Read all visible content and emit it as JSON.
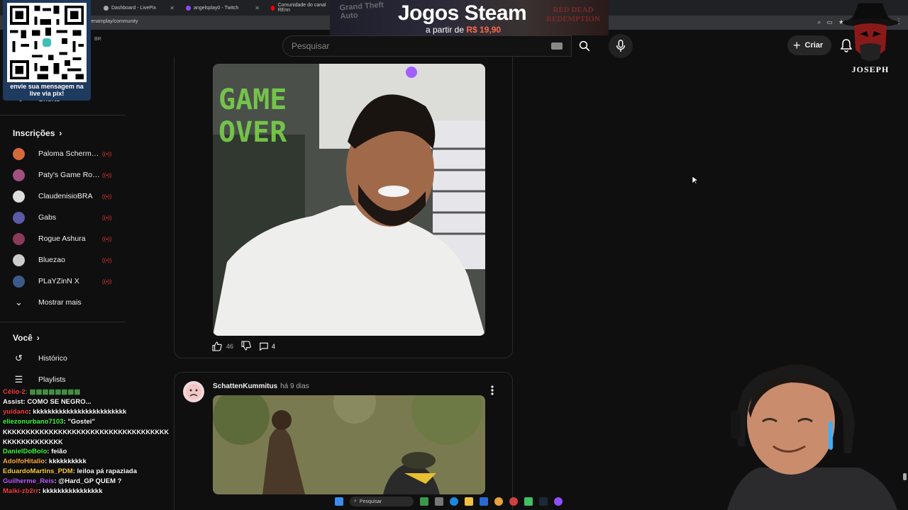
{
  "browser": {
    "tabs": [
      {
        "label": "Dashboard - LivePix",
        "color": "#9aa0a6"
      },
      {
        "label": "angelsplay0 - Twitch",
        "color": "#9146ff"
      },
      {
        "label": "Comunidade do canal REnn",
        "color": "#ff0000"
      }
    ],
    "address": "renamplay/community"
  },
  "promo": {
    "title": "Jogos Steam",
    "subtitle_prefix": "a partir de",
    "price": "R$ 19,90",
    "left_logo_text": "Grand Theft Auto",
    "right_logo_text": "RED DEAD REDEMPTION"
  },
  "header": {
    "search_placeholder": "Pesquisar",
    "create_label": "Criar",
    "region_badge": "BR"
  },
  "overlay": {
    "qr_caption": "envie sua mensagem na live via pix!",
    "joseph_name": "JOSEPH"
  },
  "sidebar": {
    "shorts_label": "Shorts",
    "subscriptions_header": "Inscrições",
    "subscriptions": [
      {
        "name": "Paloma Scherma...",
        "color": "#d46a3a"
      },
      {
        "name": "Paty's Game Roo...",
        "color": "#a05080"
      },
      {
        "name": "ClaudenisioBRA",
        "color": "#ddd"
      },
      {
        "name": "Gabs",
        "color": "#5a5aa8"
      },
      {
        "name": "Rogue Ashura",
        "color": "#8a3a5a"
      },
      {
        "name": "Bluezao",
        "color": "#ccc"
      },
      {
        "name": "PLaYZinN X",
        "color": "#3a5a8a"
      }
    ],
    "show_more_label": "Mostrar mais",
    "you_header": "Você",
    "history_label": "Histórico",
    "playlists_label": "Playlists"
  },
  "post1": {
    "image_text": "GAME OVER",
    "likes": "46",
    "comments": "4"
  },
  "post2": {
    "author": "SchattenKummitus",
    "time": "há 9 dias"
  },
  "chat": [
    {
      "user": "Célio-2",
      "msg": ": ▩▩▩▩▩▩▩▩",
      "color": "#ff4040"
    },
    {
      "user": "",
      "msg": "Assist: COMO SE NEGRO...",
      "color": "#ffffff"
    },
    {
      "user": "yuidano",
      "msg": ": kkkkkkkkkkkkkkkkkkkkkkkkk",
      "color": "#ff4040"
    },
    {
      "user": "eliezonurbano7103",
      "msg": ": \"Gostei\"",
      "color": "#40ff40"
    },
    {
      "user": "",
      "msg": "KKKKKKKKKKKKKKKKKKKKKKKKKKKKKKKKKKKKKKKKKKKKKKKKK",
      "color": "#ffffff",
      "wrap": true
    },
    {
      "user": "DanielDoBolo",
      "msg": ": feião",
      "color": "#40ff40"
    },
    {
      "user": "AdolfoHitallo",
      "msg": ": kkkkkkkkkk",
      "color": "#ffb040"
    },
    {
      "user": "EduardoMartins_PDM",
      "msg": ": leiloa pá rapaziada",
      "color": "#ffd040",
      "wrap": true
    },
    {
      "user": "Guilherme_Reis",
      "msg": ": @Hard_GP QUEM ?",
      "color": "#c060ff"
    },
    {
      "user": "Maiki-zb2rr",
      "msg": ": kkkkkkkkkkkkkkkk",
      "color": "#ff4040"
    }
  ],
  "taskbar": {
    "search_label": "Pesquisar"
  }
}
